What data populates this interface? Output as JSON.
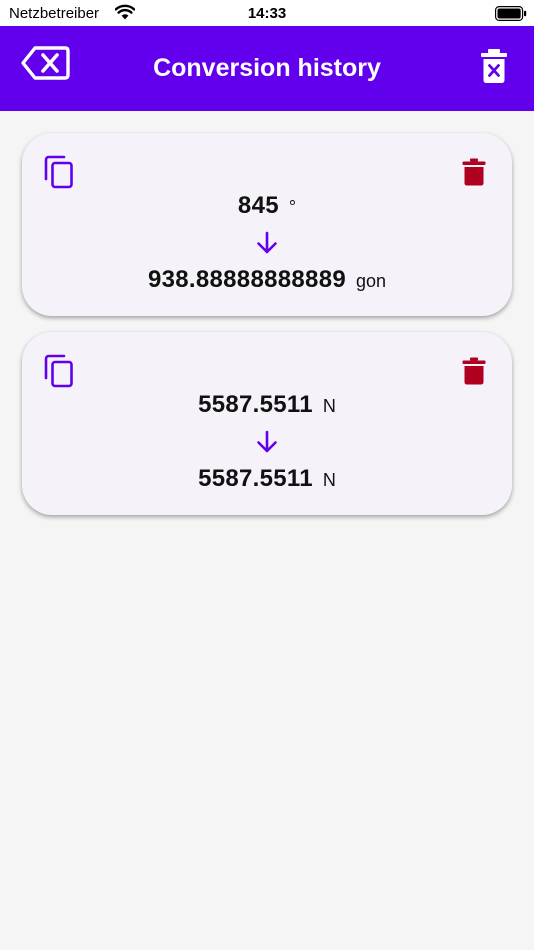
{
  "status_bar": {
    "carrier": "Netzbetreiber",
    "time": "14:33"
  },
  "app_bar": {
    "title": "Conversion history",
    "back_icon": "backspace-icon",
    "clear_icon": "delete-sweep-icon",
    "background_color": "#6200ee"
  },
  "history": [
    {
      "from_value": "845",
      "from_unit": "°",
      "to_value": "938.88888888889",
      "to_unit": "gon"
    },
    {
      "from_value": "5587.5511",
      "from_unit": "N",
      "to_value": "5587.5511",
      "to_unit": "N"
    }
  ],
  "colors": {
    "accent": "#6200ee",
    "delete": "#b00020",
    "card_bg": "#f6f2fa"
  }
}
